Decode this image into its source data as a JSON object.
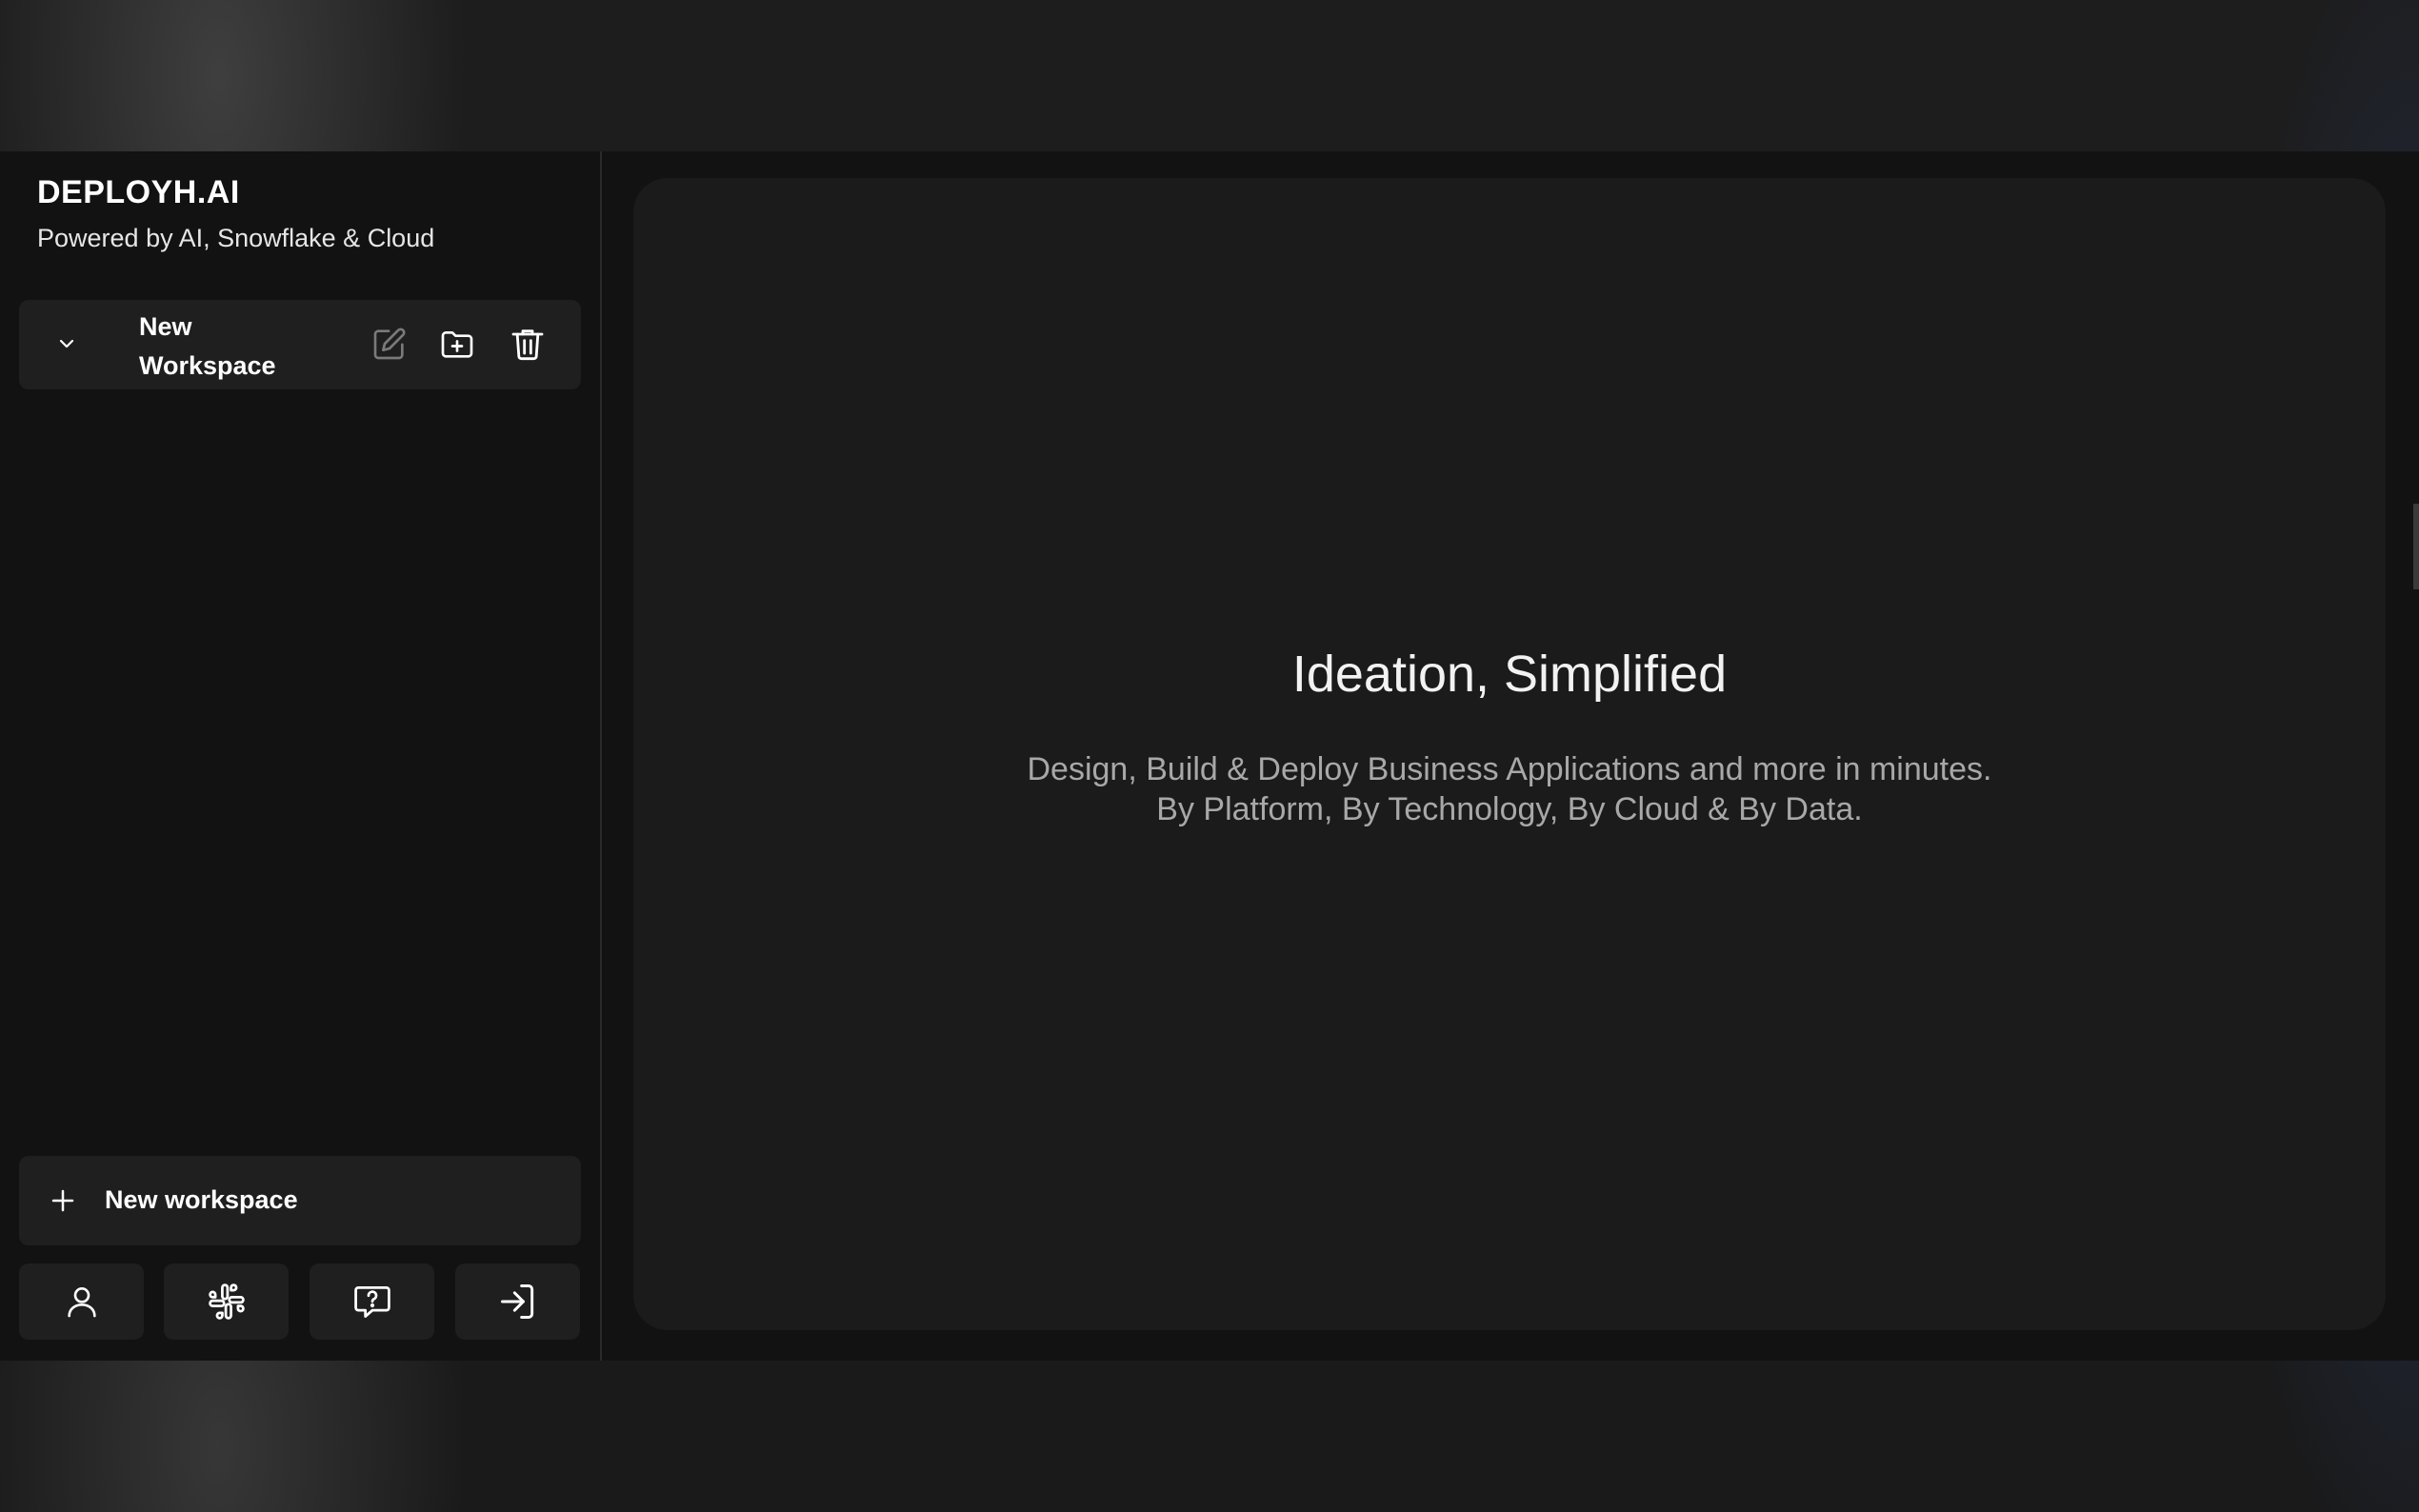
{
  "sidebar": {
    "brand_title": "DEPLOYH.AI",
    "brand_subtitle": "Powered by AI, Snowflake & Cloud",
    "workspace": {
      "name": "New Workspace",
      "icons": [
        "chevron-down-icon",
        "edit-icon",
        "folder-plus-icon",
        "trash-icon"
      ]
    },
    "new_workspace_label": "New workspace",
    "bottom_buttons": [
      "user-icon",
      "slack-icon",
      "help-chat-icon",
      "login-icon"
    ]
  },
  "main": {
    "title": "Ideation, Simplified",
    "desc_line1": "Design, Build & Deploy Business Applications and more in minutes.",
    "desc_line2": "By Platform, By Technology, By Cloud & By Data."
  },
  "colors": {
    "background": "#121212",
    "card": "#1f1f20",
    "main_card": "#1b1b1c",
    "text": "#ffffff",
    "muted_text": "#a8a8a8"
  }
}
